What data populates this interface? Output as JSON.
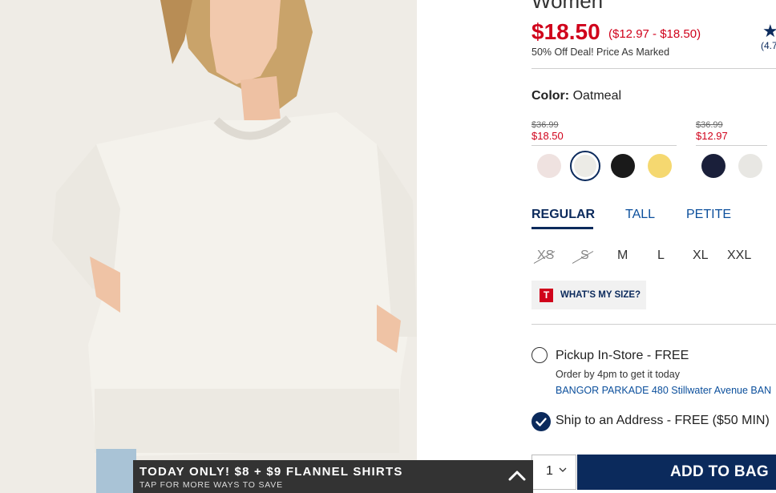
{
  "product": {
    "title": "Women",
    "price": "$18.50",
    "price_range": "($12.97 - $18.50)",
    "deal_text": "50% Off Deal! Price As Marked",
    "rating_text": "(4.7",
    "colors": {
      "label": "Color:",
      "selected_name": "Oatmeal",
      "groups": [
        {
          "old_price": "$36.99",
          "new_price": "$18.50",
          "swatches": [
            {
              "name": "blush-pink",
              "color": "#efe2e0"
            },
            {
              "name": "oatmeal",
              "color": "#ecebe6",
              "selected": true
            },
            {
              "name": "black",
              "color": "#1a1a1a"
            },
            {
              "name": "yellow",
              "color": "#f5d870"
            }
          ]
        },
        {
          "old_price": "$36.99",
          "new_price": "$12.97",
          "swatches": [
            {
              "name": "navy",
              "color": "#1a1f3a"
            },
            {
              "name": "light-grey",
              "color": "#e8e7e3"
            }
          ]
        }
      ]
    },
    "fit_tabs": [
      {
        "label": "REGULAR",
        "active": true
      },
      {
        "label": "TALL",
        "active": false
      },
      {
        "label": "PETITE",
        "active": false
      }
    ],
    "sizes": [
      {
        "label": "XS",
        "available": false
      },
      {
        "label": "S",
        "available": false
      },
      {
        "label": "M",
        "available": true
      },
      {
        "label": "L",
        "available": true
      },
      {
        "label": "XL",
        "available": true
      },
      {
        "label": "XXL",
        "available": true
      }
    ],
    "size_help": {
      "badge": "T",
      "label": "WHAT'S MY SIZE?"
    }
  },
  "fulfillment": {
    "pickup_label": "Pickup In-Store - FREE",
    "pickup_note": "Order by 4pm to get it today",
    "store_name": "BANGOR PARKADE 480 Stillwater Avenue  BAN",
    "ship_label": "Ship to an Address - FREE ($50 MIN)"
  },
  "cart": {
    "quantity": "1",
    "add_label": "ADD TO BAG"
  },
  "promo": {
    "title": "TODAY ONLY! $8 + $9 FLANNEL SHIRTS",
    "subtitle": "TAP FOR MORE WAYS TO SAVE"
  },
  "colors": {
    "brand_navy": "#0b2a5c",
    "sale_red": "#d0021b",
    "promo_bg": "#333333"
  }
}
